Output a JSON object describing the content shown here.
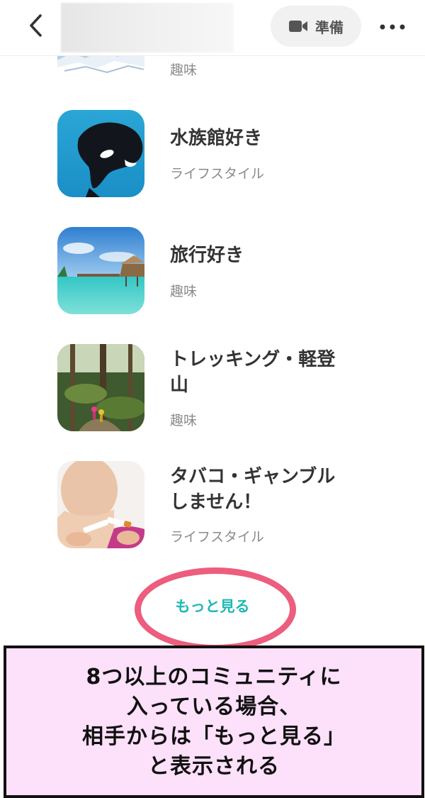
{
  "header": {
    "back_icon": "chevron-left-icon",
    "prepare_label": "準備",
    "video_icon": "video-camera-icon",
    "more_icon": "more-horizontal-icon"
  },
  "communities": [
    {
      "title": "",
      "category": "趣味",
      "image": "snow-mountain"
    },
    {
      "title": "水族館好き",
      "category": "ライフスタイル",
      "image": "orca-underwater"
    },
    {
      "title": "旅行好き",
      "category": "趣味",
      "image": "overwater-bungalows"
    },
    {
      "title": "トレッキング・軽登山",
      "title_line1": "トレッキング・軽登",
      "title_line2": "山",
      "category": "趣味",
      "image": "forest-trail"
    },
    {
      "title": "タバコ・ギャンブルしません！",
      "title_line1": "タバコ・ギャンブル",
      "title_line2": "しません！",
      "category": "ライフスタイル",
      "image": "broken-cigarette"
    }
  ],
  "more_link": "もっと見る",
  "annotation": {
    "line1": "8つ以上のコミュニティに",
    "line2": "入っている場合、",
    "line3": "相手からは「もっと見る」",
    "line4": "と表示される"
  },
  "colors": {
    "accent": "#1fb8b4",
    "highlight": "#ec5d7e",
    "annotation_bg": "#fde0fa"
  }
}
